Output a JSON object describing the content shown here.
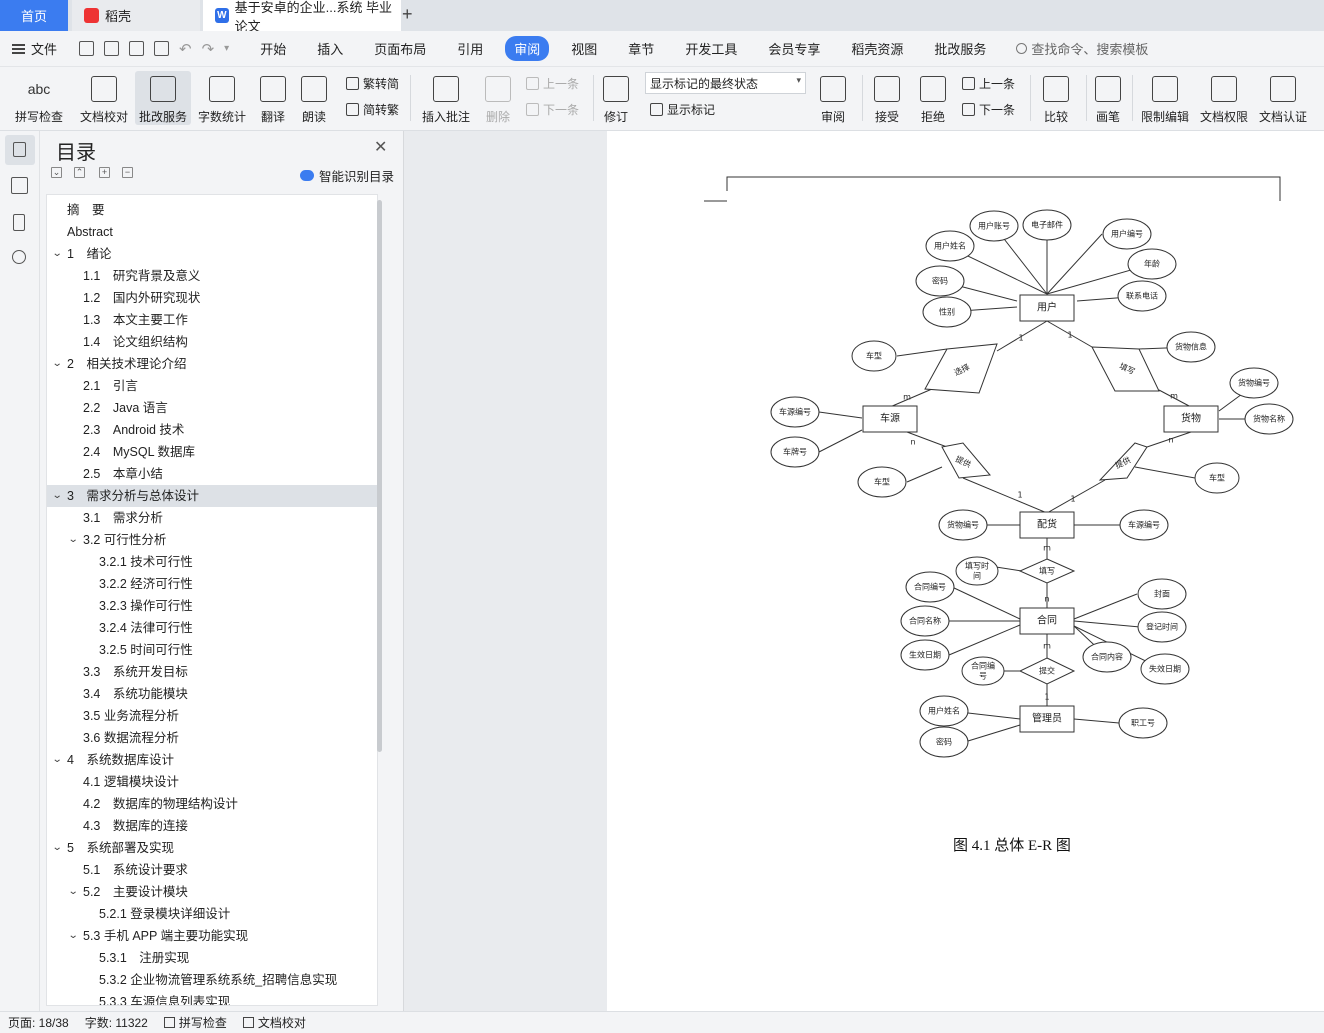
{
  "tabs": {
    "home": "首页",
    "daoke": "稻壳",
    "document": "基于安卓的企业...系统 毕业论文",
    "add": "+"
  },
  "menu": {
    "file": "文件",
    "items": [
      "开始",
      "插入",
      "页面布局",
      "引用",
      "审阅",
      "视图",
      "章节",
      "开发工具",
      "会员专享",
      "稻壳资源",
      "批改服务"
    ],
    "active_index": 4,
    "search_placeholder": "查找命令、搜索模板"
  },
  "ribbon": {
    "spell": "拼写检查",
    "proof": "文档校对",
    "review_service": "批改服务",
    "word_count": "字数统计",
    "translate": "翻译",
    "read": "朗读",
    "to_traditional": "繁转简",
    "to_simplified": "简转繁",
    "insert_comment": "插入批注",
    "delete": "删除",
    "prev": "上一条",
    "next": "下一条",
    "track": "修订",
    "markup_state": "显示标记的最终状态",
    "show_markup": "显示标记",
    "review": "审阅",
    "accept": "接受",
    "reject": "拒绝",
    "prev2": "上一条",
    "next2": "下一条",
    "compare": "比较",
    "pen": "画笔",
    "restrict_edit": "限制编辑",
    "doc_rights": "文档权限",
    "doc_cert": "文档认证",
    "abc": "abc"
  },
  "toc": {
    "title": "目录",
    "smart": "智能识别目录",
    "items": [
      {
        "text": "摘　要",
        "level": 0,
        "chev": false
      },
      {
        "text": "Abstract",
        "level": 0,
        "chev": false
      },
      {
        "text": "1　绪论",
        "level": 0,
        "chev": true
      },
      {
        "text": "1.1　研究背景及意义",
        "level": 1,
        "chev": false
      },
      {
        "text": "1.2　国内外研究现状",
        "level": 1,
        "chev": false
      },
      {
        "text": "1.3　本文主要工作",
        "level": 1,
        "chev": false
      },
      {
        "text": "1.4　论文组织结构",
        "level": 1,
        "chev": false
      },
      {
        "text": "2　相关技术理论介绍",
        "level": 0,
        "chev": true
      },
      {
        "text": "2.1　引言",
        "level": 1,
        "chev": false
      },
      {
        "text": "2.2　Java 语言",
        "level": 1,
        "chev": false
      },
      {
        "text": "2.3　Android 技术",
        "level": 1,
        "chev": false
      },
      {
        "text": "2.4　MySQL 数据库",
        "level": 1,
        "chev": false
      },
      {
        "text": "2.5　本章小结",
        "level": 1,
        "chev": false
      },
      {
        "text": "3　需求分析与总体设计",
        "level": 0,
        "chev": true,
        "highlight": true
      },
      {
        "text": "3.1　需求分析",
        "level": 1,
        "chev": false
      },
      {
        "text": "3.2 可行性分析",
        "level": 1,
        "chev": true
      },
      {
        "text": "3.2.1 技术可行性",
        "level": 2,
        "chev": false
      },
      {
        "text": "3.2.2 经济可行性",
        "level": 2,
        "chev": false
      },
      {
        "text": "3.2.3 操作可行性",
        "level": 2,
        "chev": false
      },
      {
        "text": "3.2.4 法律可行性",
        "level": 2,
        "chev": false
      },
      {
        "text": "3.2.5 时间可行性",
        "level": 2,
        "chev": false
      },
      {
        "text": "3.3　系统开发目标",
        "level": 1,
        "chev": false
      },
      {
        "text": "3.4　系统功能模块",
        "level": 1,
        "chev": false
      },
      {
        "text": "3.5 业务流程分析",
        "level": 1,
        "chev": false
      },
      {
        "text": "3.6 数据流程分析",
        "level": 1,
        "chev": false
      },
      {
        "text": "4　系统数据库设计",
        "level": 0,
        "chev": true
      },
      {
        "text": "4.1 逻辑模块设计",
        "level": 1,
        "chev": false
      },
      {
        "text": "4.2　数据库的物理结构设计",
        "level": 1,
        "chev": false
      },
      {
        "text": "4.3　数据库的连接",
        "level": 1,
        "chev": false
      },
      {
        "text": "5　系统部署及实现",
        "level": 0,
        "chev": true
      },
      {
        "text": "5.1　系统设计要求",
        "level": 1,
        "chev": false
      },
      {
        "text": "5.2　主要设计模块",
        "level": 1,
        "chev": true
      },
      {
        "text": "5.2.1 登录模块详细设计",
        "level": 2,
        "chev": false
      },
      {
        "text": "5.3 手机 APP 端主要功能实现",
        "level": 1,
        "chev": true
      },
      {
        "text": "5.3.1　注册实现",
        "level": 2,
        "chev": false
      },
      {
        "text": "5.3.2 企业物流管理系统系统_招聘信息实现",
        "level": 2,
        "chev": false
      },
      {
        "text": "5.3.3 车源信息列表实现",
        "level": 2,
        "chev": false
      }
    ]
  },
  "er": {
    "entities": {
      "user": "用户",
      "car": "车源",
      "goods": "货物",
      "dispatch": "配货",
      "contract": "合同",
      "admin": "管理员"
    },
    "relations": {
      "choose": "选择",
      "fill1": "填写",
      "provide1": "提供",
      "provide2": "提供",
      "fill2": "填写",
      "submit": "提交"
    },
    "attributes": {
      "user_account": "用户账号",
      "email": "电子邮件",
      "user_name": "用户姓名",
      "user_no": "用户编号",
      "age": "年龄",
      "password": "密码",
      "phone": "联系电话",
      "gender": "性别",
      "car_type1": "车型",
      "goods_info": "货物信息",
      "car_source_no": "车源编号",
      "plate": "车牌号",
      "goods_no": "货物编号",
      "goods_name": "货物名称",
      "car_type2": "车型",
      "car_type3": "车型",
      "dispatch_goods_no": "货物编号",
      "dispatch_car_no": "车源编号",
      "fill_time_a": "填写时",
      "fill_time_b": "间",
      "contract_no": "合同编号",
      "cover": "封面",
      "contract_name": "合同名称",
      "reg_time": "登记时间",
      "effective": "生效日期",
      "contract_content": "合同内容",
      "expire": "失效日期",
      "submit_no_a": "合同编",
      "submit_no_b": "号",
      "admin_name": "用户姓名",
      "admin_pwd": "密码",
      "staff_no": "职工号"
    },
    "cardinality": {
      "one": "1",
      "many": "m",
      "n": "n"
    }
  },
  "caption": "图 4.1  总体 E-R 图",
  "status": {
    "page": "页面: 18/38",
    "words": "字数: 11322",
    "spell": "拼写检查",
    "proof": "文档校对"
  }
}
